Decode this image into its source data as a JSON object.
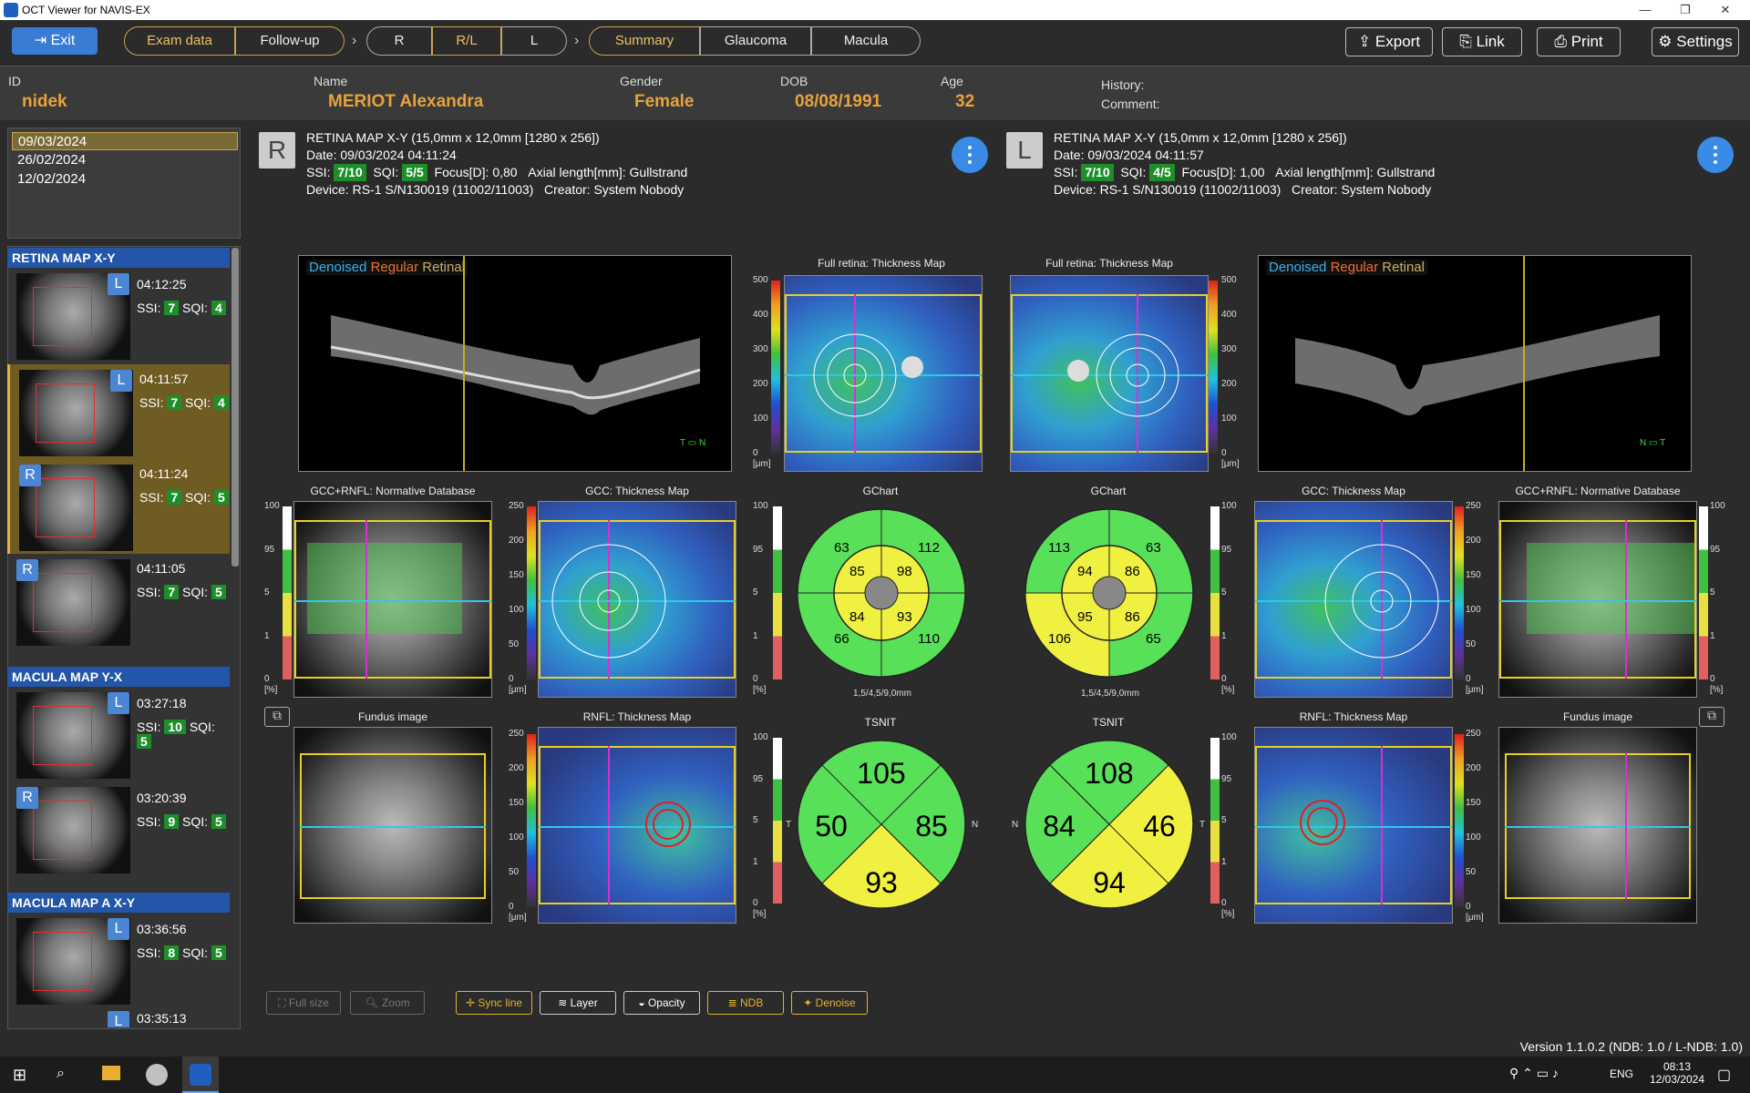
{
  "window": {
    "title": "OCT Viewer for NAVIS-EX"
  },
  "toolbar": {
    "exit": "Exit",
    "exam_data": "Exam data",
    "follow_up": "Follow-up",
    "r": "R",
    "rl": "R/L",
    "l": "L",
    "summary": "Summary",
    "glaucoma": "Glaucoma",
    "macula": "Macula",
    "export": "Export",
    "link": "Link",
    "print": "Print",
    "settings": "Settings"
  },
  "patient": {
    "id_label": "ID",
    "id": "nidek",
    "name_label": "Name",
    "name": "MERIOT Alexandra",
    "gender_label": "Gender",
    "gender": "Female",
    "dob_label": "DOB",
    "dob": "08/08/1991",
    "age_label": "Age",
    "age": "32",
    "history_label": "History:",
    "comment_label": "Comment:"
  },
  "dates": [
    "09/03/2024",
    "26/02/2024",
    "12/02/2024"
  ],
  "sections": {
    "retina": "RETINA MAP X-Y",
    "macula": "MACULA MAP Y-X",
    "macula_a": "MACULA MAP A X-Y"
  },
  "thumbs": [
    {
      "eye": "L",
      "time": "04:12:25",
      "ssi": "7",
      "sqi": "4"
    },
    {
      "eye": "L",
      "time": "04:11:57",
      "ssi": "7",
      "sqi": "4"
    },
    {
      "eye": "R",
      "time": "04:11:24",
      "ssi": "7",
      "sqi": "5"
    },
    {
      "eye": "R",
      "time": "04:11:05",
      "ssi": "7",
      "sqi": "5"
    },
    {
      "eye": "L",
      "time": "03:27:18",
      "ssi": "10",
      "sqi": "5"
    },
    {
      "eye": "R",
      "time": "03:20:39",
      "ssi": "9",
      "sqi": "5"
    },
    {
      "eye": "L",
      "time": "03:36:56",
      "ssi": "8",
      "sqi": "5"
    },
    {
      "eye": "L",
      "time": "03:35:13",
      "ssi": "",
      "sqi": ""
    }
  ],
  "labels": {
    "ssi": "SSI:",
    "sqi": "SQI:",
    "focus": "Focus[D]:",
    "axial": "Axial length[mm]:",
    "device": "Device:",
    "creator": "Creator:",
    "date": "Date:"
  },
  "right_exam": {
    "eye": "R",
    "scan": "RETINA MAP X-Y (15,0mm x 12,0mm [1280 x 256])",
    "date": "09/03/2024 04:11:24",
    "ssi": "7/10",
    "sqi": "5/5",
    "focus": "0,80",
    "axial": "Gullstrand",
    "device": "RS-1 S/N130019 (11002/11003)",
    "creator": "System Nobody"
  },
  "left_exam": {
    "eye": "L",
    "scan": "RETINA MAP X-Y (15,0mm x 12,0mm [1280 x 256])",
    "date": "09/03/2024 04:11:57",
    "ssi": "7/10",
    "sqi": "4/5",
    "focus": "1,00",
    "axial": "Gullstrand",
    "device": "RS-1 S/N130019 (11002/11003)",
    "creator": "System Nobody"
  },
  "oct": {
    "denoised": "Denoised",
    "regular": "Regular",
    "retinal": "Retinal",
    "t": "T",
    "n": "N"
  },
  "panels": {
    "full_retina": "Full retina: Thickness Map",
    "gcc_ndb": "GCC+RNFL: Normative Database",
    "gcc_thick": "GCC: Thickness Map",
    "gchart": "GChart",
    "fundus": "Fundus image",
    "rnfl_thick": "RNFL: Thickness Map",
    "tsnit": "TSNIT",
    "gchart_sub": "1,5/4,5/9,0mm",
    "um": "[μm]",
    "pct": "[%]"
  },
  "scale500": [
    "500",
    "400",
    "300",
    "200",
    "100",
    "0"
  ],
  "scale250": [
    "250",
    "200",
    "150",
    "100",
    "50",
    "0"
  ],
  "scalendb": [
    "100",
    "95",
    "5",
    "1",
    "0"
  ],
  "gchart_r": {
    "outer": [
      "63",
      "112",
      "66",
      "110"
    ],
    "inner": [
      "85",
      "98",
      "84",
      "93"
    ]
  },
  "gchart_l": {
    "outer": [
      "113",
      "63",
      "106",
      "65"
    ],
    "inner": [
      "94",
      "86",
      "95",
      "86"
    ]
  },
  "tsnit_r": {
    "top": "105",
    "left": "50",
    "right": "85",
    "bottom": "93",
    "l_side": "T",
    "r_side": "N"
  },
  "tsnit_l": {
    "top": "108",
    "left": "84",
    "right": "46",
    "bottom": "94",
    "l_side": "N",
    "r_side": "T"
  },
  "bottom_buttons": {
    "full": "Full size",
    "zoom": "Zoom",
    "sync": "Sync line",
    "layer": "Layer",
    "opacity": "Opacity",
    "ndb": "NDB",
    "denoise": "Denoise"
  },
  "status": {
    "version": "Version 1.1.0.2 (NDB: 1.0 / L-NDB: 1.0)"
  },
  "taskbar": {
    "lang": "ENG",
    "time": "08:13",
    "date": "12/03/2024"
  },
  "colors": {
    "accent": "#3a7bd5",
    "gold": "#e8a23a",
    "green": "#59e059",
    "yellow": "#f0f040"
  }
}
